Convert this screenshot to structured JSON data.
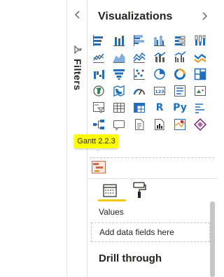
{
  "filters_pane": {
    "label": "Filters",
    "icons": {
      "collapse": "chevron-left-icon",
      "funnel": "funnel-icon"
    }
  },
  "visualizations_pane": {
    "title": "Visualizations",
    "expand_icon": "chevron-right-icon",
    "visuals": [
      "stacked-bar-chart",
      "stacked-column-chart",
      "clustered-bar-chart",
      "clustered-column-chart",
      "100-stacked-bar-chart",
      "100-stacked-column-chart",
      "line-chart",
      "area-chart",
      "stacked-area-chart",
      "line-and-stacked-column-chart",
      "line-and-clustered-column-chart",
      "ribbon-chart",
      "waterfall-chart",
      "funnel-chart",
      "scatter-chart",
      "pie-chart",
      "donut-chart",
      "treemap",
      "map",
      "filled-map",
      "gauge",
      "card",
      "multi-row-card",
      "kpi",
      "slicer",
      "table",
      "matrix",
      "r-script-visual",
      "python-visual",
      "key-influencers",
      "decomposition-tree",
      "qa",
      "smart-narrative",
      "paginated-report",
      "azure-map",
      "power-apps"
    ],
    "text_visuals": {
      "r": "R",
      "py": "Py"
    },
    "tooltip": "Gantt 2.2.3",
    "custom_visual": "gantt-chart-icon",
    "tabs": [
      {
        "name": "fields",
        "icon": "fields-icon",
        "active": true
      },
      {
        "name": "format",
        "icon": "paint-roller-icon",
        "active": false
      }
    ],
    "well": {
      "label": "Values",
      "placeholder": "Add data fields here"
    },
    "drill_through": "Drill through"
  },
  "colors": {
    "accent": "#f2c811",
    "tooltip": "#fffe00",
    "icon_blue": "#1f6fbe"
  }
}
